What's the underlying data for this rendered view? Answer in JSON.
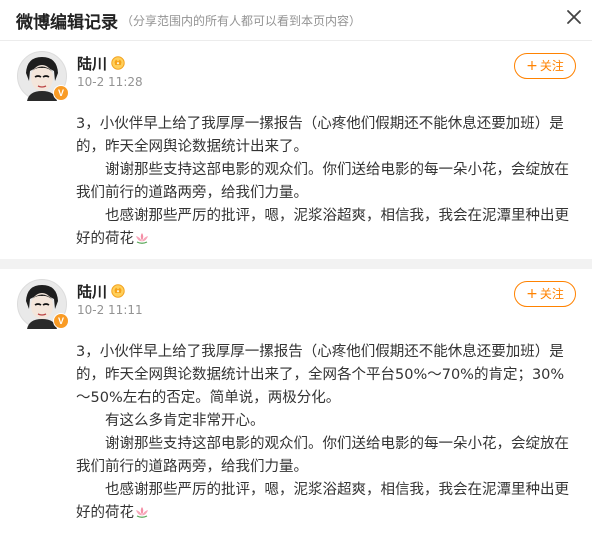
{
  "header": {
    "title": "微博编辑记录",
    "subtitle": "（分享范围内的所有人都可以看到本页内容）",
    "close_icon": "close-icon"
  },
  "colors": {
    "accent": "#ff8200",
    "badge": "#f99b25",
    "muted": "#939393",
    "separator": "#f2f2f2"
  },
  "posts": [
    {
      "author": "陆川",
      "time": "10-2 11:28",
      "follow_label": "关注",
      "paragraphs": [
        "3，小伙伴早上给了我厚厚一摞报告（心疼他们假期还不能休息还要加班）是的，昨天全网舆论数据统计出来了。",
        "谢谢那些支持这部电影的观众们。你们送给电影的每一朵小花，会绽放在我们前行的道路两旁，给我们力量。",
        "也感谢那些严厉的批评，嗯，泥浆浴超爽，相信我，我会在泥潭里种出更好的荷花"
      ]
    },
    {
      "author": "陆川",
      "time": "10-2 11:11",
      "follow_label": "关注",
      "paragraphs": [
        "3，小伙伴早上给了我厚厚一摞报告（心疼他们假期还不能休息还要加班）是的，昨天全网舆论数据统计出来了，全网各个平台50%～70%的肯定；30%～50%左右的否定。简单说，两极分化。",
        "有这么多肯定非常开心。",
        "谢谢那些支持这部电影的观众们。你们送给电影的每一朵小花，会绽放在我们前行的道路两旁，给我们力量。",
        "也感谢那些严厉的批评，嗯，泥浆浴超爽，相信我，我会在泥潭里种出更好的荷花"
      ]
    }
  ]
}
